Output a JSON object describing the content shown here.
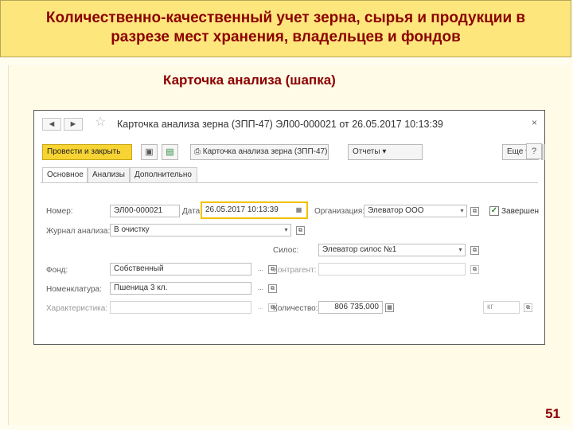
{
  "slide": {
    "title_line1": "Количественно-качественный учет зерна, сырья и продукции в",
    "title_line2": "разрезе мест хранения, владельцев и фондов",
    "subtitle": "Карточка анализа (шапка)",
    "page_number": "51"
  },
  "window": {
    "title": "Карточка анализа зерна (ЗПП-47) ЭЛ00-000021 от 26.05.2017 10:13:39",
    "close": "×",
    "back_glyph": "◄",
    "forward_glyph": "►",
    "star_glyph": "☆"
  },
  "toolbar": {
    "post_close": "Провести и закрыть",
    "print_form": "Карточка анализа зерна (ЗПП-47)",
    "reports": "Отчеты",
    "more": "Еще",
    "help": "?",
    "save_glyph": "▣",
    "post_glyph": "▤",
    "print_glyph": "⎙",
    "dropdown_glyph": "▾"
  },
  "tabs": [
    "Основное",
    "Анализы",
    "Дополнительно"
  ],
  "form": {
    "number_label": "Номер:",
    "number_value": "ЭЛ00-000021",
    "date_label": "Дата:",
    "date_value": "26.05.2017 10:13:39",
    "organization_label": "Организация:",
    "organization_value": "Элеватор ООО",
    "completed_label": "Завершен",
    "completed_checked": true,
    "journal_label": "Журнал анализа:",
    "journal_value": "В очистку",
    "silo_label": "Силос:",
    "silo_value": "Элеватор силос №1",
    "fund_label": "Фонд:",
    "fund_value": "Собственный",
    "counterparty_label": "Контрагент:",
    "nomenclature_label": "Номенклатура:",
    "nomenclature_value": "Пшеница 3 кл.",
    "characteristic_label": "Характеристика:",
    "quantity_label": "Количество:",
    "quantity_value": "806 735,000",
    "unit_value": "кг"
  },
  "glyphs": {
    "dropdown": "▾",
    "ellipsis": "...",
    "open_item": "⧉",
    "calendar": "▦",
    "calculator": "▦",
    "check": "✓"
  }
}
